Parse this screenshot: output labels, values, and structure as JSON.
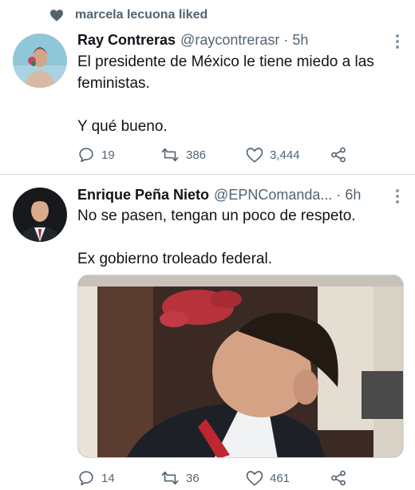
{
  "social_context": {
    "text": "marcela lecuona liked",
    "icon": "heart-icon"
  },
  "tweets": [
    {
      "name": "Ray Contreras",
      "handle": "@raycontrerasr",
      "time": "5h",
      "lines": [
        "El presidente de México le tiene miedo a las feministas.",
        "Y qué bueno."
      ],
      "replies": "19",
      "retweets": "386",
      "likes": "3,444"
    },
    {
      "name": "Enrique Peña Nieto",
      "handle": "@EPNComanda...",
      "time": "6h",
      "lines": [
        "No se pasen, tengan un poco de respeto.",
        "Ex gobierno troleado federal."
      ],
      "replies": "14",
      "retweets": "36",
      "likes": "461"
    }
  ],
  "colors": {
    "text": "#0f1419",
    "secondary": "#536471",
    "icon": "#536471",
    "divider": "#d8dde1"
  }
}
